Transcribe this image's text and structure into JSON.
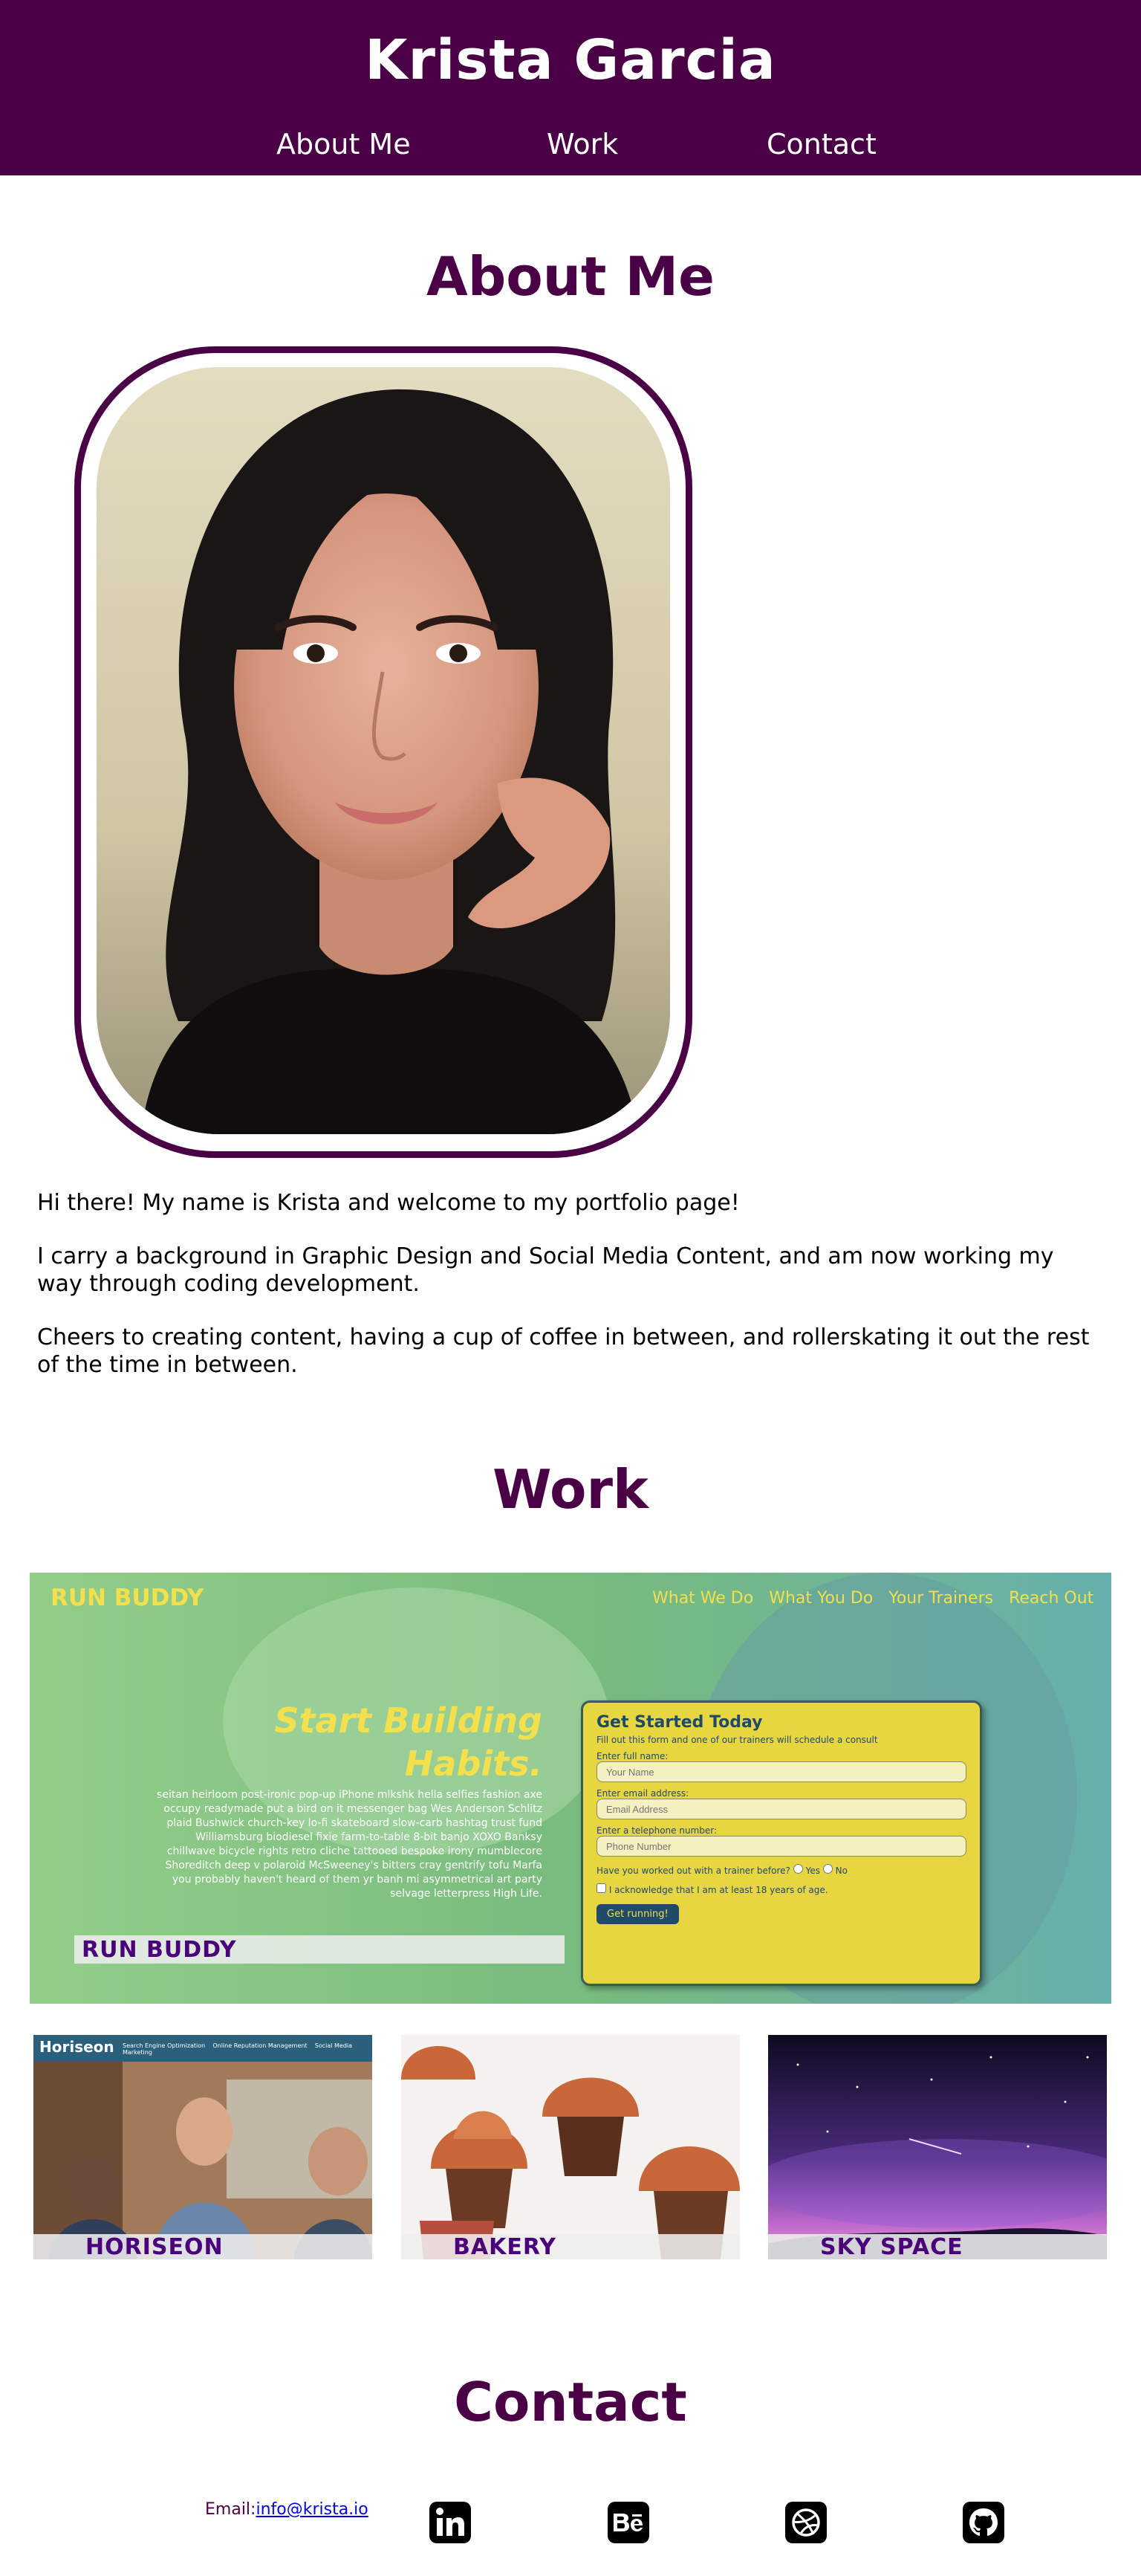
{
  "header": {
    "title": "Krista Garcia",
    "nav": {
      "about": "About Me",
      "work": "Work",
      "contact": "Contact"
    }
  },
  "about": {
    "heading": "About Me",
    "paragraphs": [
      "Hi there! My name is Krista and welcome to my portfolio page!",
      "I carry a background in Graphic Design and Social Media Content, and am now working my way through coding development.",
      "Cheers to creating content, having a cup of coffee in between, and rollerskating it out the rest of the time in between."
    ]
  },
  "work": {
    "heading": "Work",
    "main_project": {
      "label": "RUN BUDDY",
      "screenshot": {
        "brand": "RUN BUDDY",
        "nav": [
          "What We Do",
          "What You Do",
          "Your Trainers",
          "Reach Out"
        ],
        "hero_title_line1": "Start Building",
        "hero_title_line2": "Habits.",
        "hero_body": "seitan heirloom post-ironic pop-up iPhone mlkshk hella selfies fashion axe occupy readymade put a bird on it messenger bag Wes Anderson Schlitz plaid Bushwick church-key lo-fi skateboard slow-carb hashtag trust fund Williamsburg biodiesel fixie farm-to-table 8-bit banjo XOXO Banksy chillwave bicycle rights retro cliche tattooed bespoke irony mumblecore Shoreditch deep v polaroid McSweeney's bitters cray gentrify tofu Marfa you probably haven't heard of them yr banh mi asymmetrical art party selvage letterpress High Life.",
        "form_title": "Get Started Today",
        "form_subtitle": "Fill out this form and one of our trainers will schedule a consult",
        "name_label": "Enter full name:",
        "name_placeholder": "Your Name",
        "email_label": "Enter email address:",
        "email_placeholder": "Email Address",
        "phone_label": "Enter a telephone number:",
        "phone_placeholder": "Phone Number",
        "trainer_question": "Have you worked out with a trainer before?",
        "yes": "Yes",
        "no": "No",
        "acknowledge": "I acknowledge that I am at least 18 years of age.",
        "submit": "Get running!"
      }
    },
    "projects": [
      {
        "label": "HORISEON",
        "screenshot_brand": "Horiseon",
        "screenshot_nav": [
          "Search Engine Optimization",
          "Online Reputation Management",
          "Social Media Marketing"
        ]
      },
      {
        "label": "BAKERY"
      },
      {
        "label": "SKY SPACE"
      }
    ]
  },
  "contact": {
    "heading": "Contact",
    "email_label": "Email:",
    "email": "info@krista.io",
    "icons": [
      "linkedin-icon",
      "behance-icon",
      "dribbble-icon",
      "github-icon"
    ]
  },
  "colors": {
    "brand_purple": "#4a0045",
    "label_purple": "#4a007a",
    "runbuddy_yellow": "#f4e04d"
  }
}
